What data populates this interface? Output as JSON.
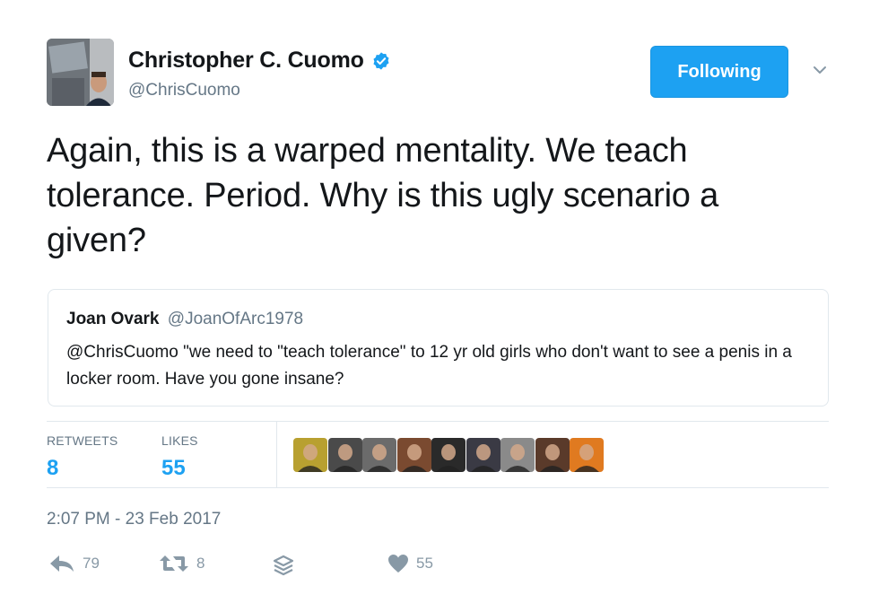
{
  "author": {
    "name": "Christopher C. Cuomo",
    "handle": "@ChrisCuomo",
    "avatar_icon": "profile-photo",
    "verified_icon": "verified-badge-icon"
  },
  "follow_button": {
    "label": "Following"
  },
  "caret_icon": "chevron-down-icon",
  "tweet_text": "Again, this is a warped mentality. We teach tolerance. Period. Why is this ugly scenario a given?",
  "quoted_tweet": {
    "name": "Joan Ovark",
    "handle": "@JoanOfArc1978",
    "text": "@ChrisCuomo  \"we need to \"teach tolerance\" to 12 yr old girls who don't want to see a penis in a locker room. Have you gone insane?"
  },
  "stats": {
    "retweets_label": "RETWEETS",
    "retweets_value": "8",
    "likes_label": "LIKES",
    "likes_value": "55"
  },
  "likers": [
    {
      "color": "#b8a030"
    },
    {
      "color": "#4a4a4a"
    },
    {
      "color": "#6b6b6b"
    },
    {
      "color": "#7a4a30"
    },
    {
      "color": "#2a2a2a"
    },
    {
      "color": "#3a3a44"
    },
    {
      "color": "#8a8a8a"
    },
    {
      "color": "#5a3a2a"
    },
    {
      "color": "#e07a20"
    }
  ],
  "timestamp": "2:07 PM - 23 Feb 2017",
  "actions": {
    "reply_count": "79",
    "retweet_count": "8",
    "like_count": "55"
  },
  "colors": {
    "accent": "#1da1f2",
    "muted": "#657786",
    "border": "#e1e8ed"
  }
}
